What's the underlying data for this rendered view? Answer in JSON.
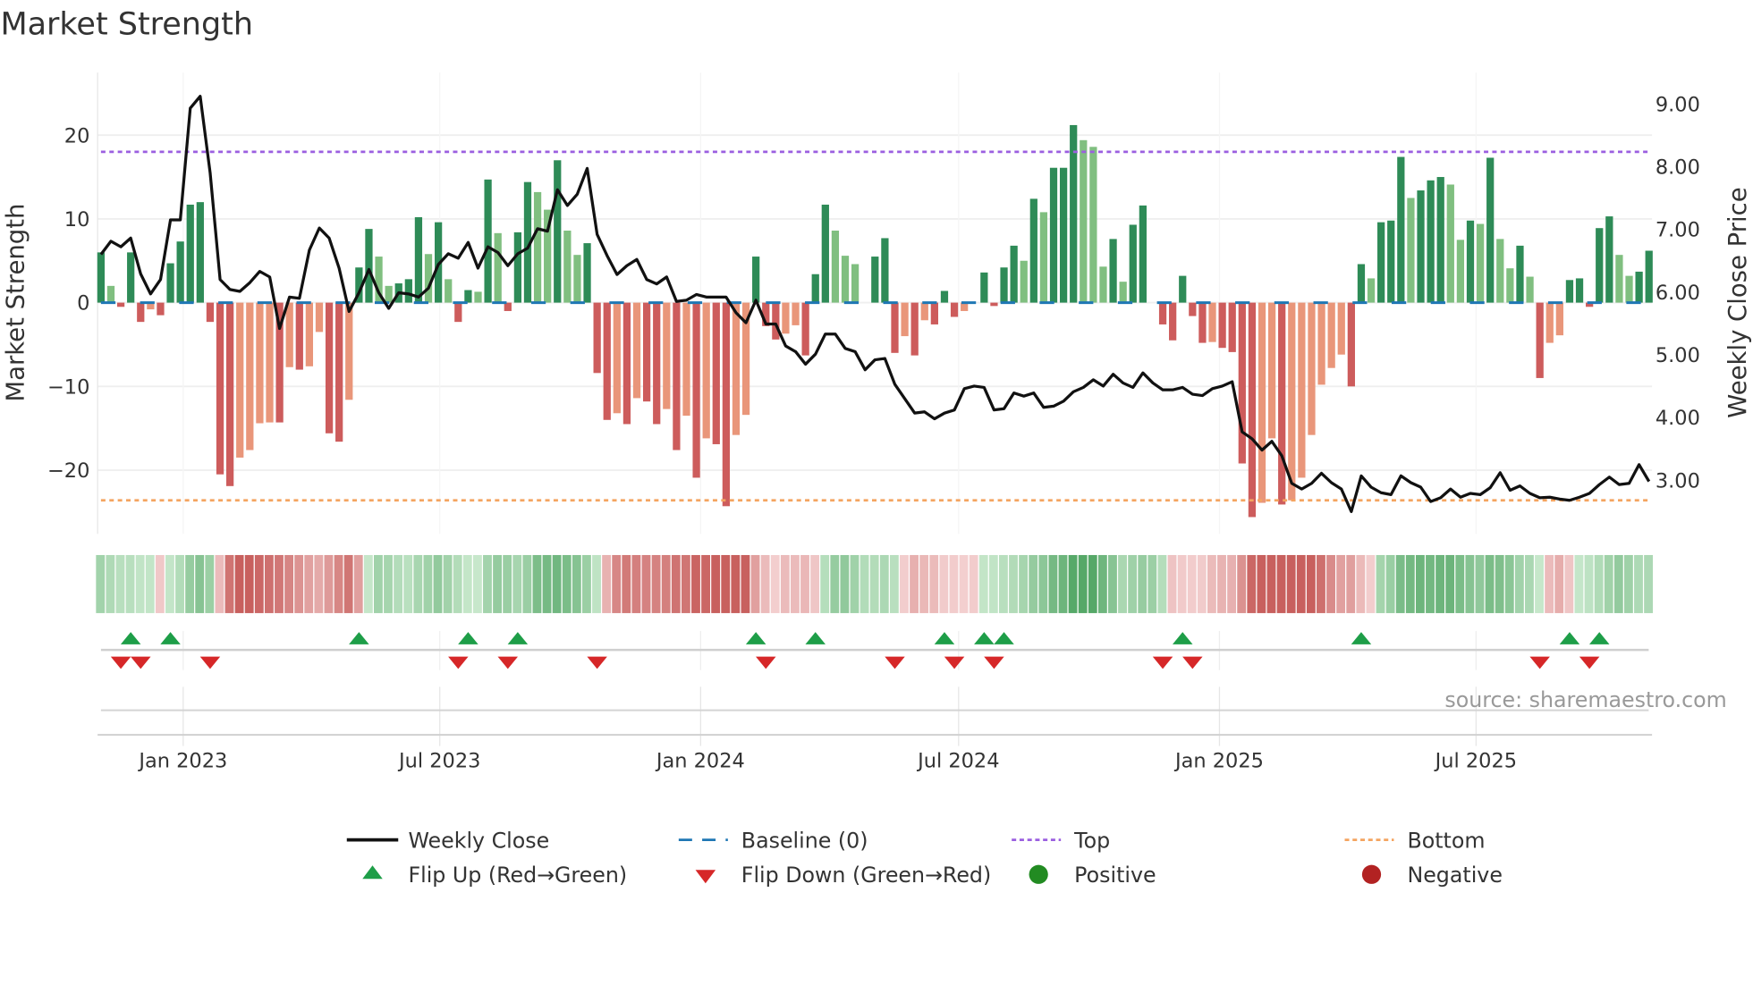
{
  "chart_data": {
    "type": "bar+line",
    "title": "Market Strength",
    "ylabel": "Market Strength",
    "y2label": "Weekly Close Price",
    "source": "source: sharemaestro.com",
    "start_date": "2022-11-04",
    "frequency": "weekly",
    "ylim": [
      -27,
      27
    ],
    "y2lim": [
      2.2,
      9.5
    ],
    "yticks": [
      20,
      10,
      0,
      -10,
      -20
    ],
    "yticklabels": [
      "20",
      "10",
      "0",
      "−10",
      "−20"
    ],
    "y2ticks": [
      9,
      8,
      7,
      6,
      5,
      4,
      3
    ],
    "y2ticklabels": [
      "9.00",
      "8.00",
      "7.00",
      "6.00",
      "5.00",
      "4.00",
      "3.00"
    ],
    "xticks": [
      {
        "date": "2023-01-01",
        "label": "Jan 2023"
      },
      {
        "date": "2023-07-01",
        "label": "Jul 2023"
      },
      {
        "date": "2024-01-01",
        "label": "Jan 2024"
      },
      {
        "date": "2024-07-01",
        "label": "Jul 2024"
      },
      {
        "date": "2025-01-01",
        "label": "Jan 2025"
      },
      {
        "date": "2025-07-01",
        "label": "Jul 2025"
      }
    ],
    "top_threshold": 18,
    "bottom_threshold": -23.6,
    "baseline": 0,
    "strength": [
      6,
      2,
      -0.5,
      6,
      -2.3,
      -0.8,
      -1.5,
      4.7,
      7.3,
      11.7,
      12,
      -2.3,
      -20.5,
      -21.9,
      -18.5,
      -17.6,
      -14.4,
      -14.3,
      -14.3,
      -7.7,
      -8,
      -7.6,
      -3.5,
      -15.6,
      -16.6,
      -11.6,
      4.2,
      8.8,
      5.5,
      2,
      2.3,
      2.8,
      10.2,
      5.8,
      9.6,
      2.8,
      -2.3,
      1.5,
      1.3,
      14.7,
      8.3,
      -1,
      8.4,
      14.4,
      13.2,
      11.1,
      17,
      8.6,
      5.7,
      7.1,
      -8.4,
      -14,
      -13.2,
      -14.5,
      -11.4,
      -11.8,
      -14.5,
      -12.7,
      -17.6,
      -13.5,
      -20.9,
      -16.2,
      -16.9,
      -24.3,
      -15.8,
      -13.4,
      5.5,
      -2.8,
      -4.4,
      -3.7,
      -2.7,
      -6.3,
      3.4,
      11.7,
      8.6,
      5.6,
      4.6,
      0,
      5.5,
      7.7,
      -6,
      -4,
      -6.3,
      -2.1,
      -2.6,
      1.4,
      -1.7,
      -1,
      0,
      3.6,
      -0.4,
      4.2,
      6.8,
      5,
      12.4,
      10.8,
      16.1,
      16.1,
      21.2,
      19.4,
      18.6,
      4.3,
      7.6,
      2.5,
      9.3,
      11.6,
      0,
      -2.6,
      -4.5,
      3.2,
      -1.6,
      -4.8,
      -4.7,
      -5.4,
      -5.9,
      -19.2,
      -25.6,
      -23.9,
      -16.2,
      -24.1,
      -23.6,
      -20.9,
      -15.8,
      -9.8,
      -7.8,
      -6.2,
      -10,
      4.6,
      2.9,
      9.6,
      9.8,
      17.4,
      12.5,
      13.4,
      14.6,
      15,
      14.1,
      7.5,
      9.8,
      9.4,
      17.3,
      7.6,
      4.1,
      6.8,
      3.1,
      -9,
      -4.8,
      -3.9,
      2.7,
      2.9,
      -0.5,
      8.9,
      10.3,
      5.7,
      3.2,
      3.7,
      6.2
    ],
    "weekly_close": [
      6.6,
      6.81,
      6.72,
      6.86,
      6.29,
      5.97,
      6.2,
      7.15,
      7.15,
      8.93,
      9.12,
      7.9,
      6.2,
      6.04,
      6.01,
      6.15,
      6.33,
      6.24,
      5.42,
      5.92,
      5.9,
      6.67,
      7.02,
      6.86,
      6.38,
      5.69,
      5.99,
      6.36,
      5.99,
      5.74,
      5.99,
      5.97,
      5.92,
      6.06,
      6.44,
      6.61,
      6.54,
      6.79,
      6.38,
      6.72,
      6.63,
      6.42,
      6.61,
      6.7,
      7.01,
      6.97,
      7.63,
      7.38,
      7.56,
      7.97,
      6.92,
      6.58,
      6.28,
      6.42,
      6.52,
      6.2,
      6.13,
      6.24,
      5.85,
      5.87,
      5.96,
      5.92,
      5.92,
      5.92,
      5.67,
      5.51,
      5.87,
      5.49,
      5.49,
      5.14,
      5.05,
      4.85,
      5.01,
      5.33,
      5.33,
      5.1,
      5.05,
      4.76,
      4.92,
      4.94,
      4.53,
      4.3,
      4.07,
      4.09,
      3.98,
      4.07,
      4.12,
      4.46,
      4.5,
      4.48,
      4.12,
      4.14,
      4.39,
      4.34,
      4.39,
      4.16,
      4.18,
      4.26,
      4.41,
      4.48,
      4.6,
      4.5,
      4.69,
      4.55,
      4.48,
      4.71,
      4.55,
      4.44,
      4.44,
      4.48,
      4.37,
      4.35,
      4.46,
      4.5,
      4.57,
      3.77,
      3.66,
      3.48,
      3.62,
      3.39,
      2.95,
      2.86,
      2.95,
      3.11,
      2.96,
      2.86,
      2.5,
      3.07,
      2.89,
      2.8,
      2.77,
      3.07,
      2.96,
      2.89,
      2.66,
      2.72,
      2.86,
      2.73,
      2.79,
      2.77,
      2.88,
      3.12,
      2.84,
      2.91,
      2.79,
      2.72,
      2.73,
      2.7,
      2.68,
      2.73,
      2.79,
      2.93,
      3.05,
      2.93,
      2.95,
      3.25,
      2.98
    ],
    "flip_up_weeks": [
      3,
      7,
      26,
      37,
      42,
      66,
      72,
      85,
      89,
      91,
      109,
      127,
      148,
      151
    ],
    "flip_down_weeks": [
      2,
      4,
      11,
      36,
      41,
      50,
      67,
      80,
      86,
      90,
      107,
      110,
      145,
      150
    ],
    "legend": [
      {
        "label": "Weekly Close",
        "symbol": "line"
      },
      {
        "label": "Baseline (0)",
        "symbol": "dash"
      },
      {
        "label": "Top",
        "symbol": "dot-purple"
      },
      {
        "label": "Bottom",
        "symbol": "dot-orange"
      },
      {
        "label": "Flip Up (Red→Green)",
        "symbol": "triangle-up"
      },
      {
        "label": "Flip Down (Green→Red)",
        "symbol": "triangle-down"
      },
      {
        "label": "Positive",
        "symbol": "circle-green"
      },
      {
        "label": "Negative",
        "symbol": "circle-red"
      }
    ],
    "legend_position": "bottom-center",
    "grid": true
  },
  "colors": {
    "pos_strong": "#2e8b57",
    "pos_weak": "#80bf80",
    "neg_strong": "#cd5c5c",
    "neg_weak": "#e9967a",
    "line": "#111111",
    "baseline": "#1f77b4",
    "top": "#9b5fe0",
    "bottom": "#f4a460",
    "flip_up": "#1e9e48",
    "flip_down": "#d62728",
    "positive": "#228b22",
    "negative": "#b22222"
  }
}
